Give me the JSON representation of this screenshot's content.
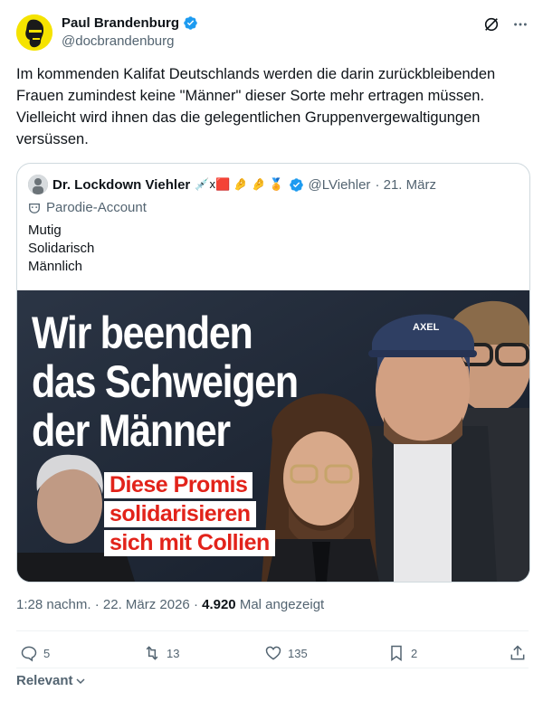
{
  "author": {
    "name": "Paul Brandenburg",
    "handle": "@docbrandenburg",
    "verified": true
  },
  "icons": {
    "header": [
      "grok-icon",
      "more-icon"
    ]
  },
  "tweet": {
    "text": "Im kommenden Kalifat Deutschlands werden die darin zurückbleibenden Frauen zumindest keine \"Männer\" dieser Sorte mehr ertragen müssen. Vielleicht wird ihnen das die gelegentlichen Gruppenvergewaltigungen versüssen."
  },
  "quote": {
    "name": "Dr. Lockdown Viehler",
    "name_emoji": "💉x🟥 🤌 🤌 🏅",
    "handle": "@LViehler",
    "date": "· 21. März",
    "label": "Parodie-Account",
    "lines": [
      "Mutig",
      "Solidarisch",
      "Männlich"
    ],
    "image": {
      "headline": [
        "Wir beenden",
        "das Schweigen",
        "der Männer"
      ],
      "subline": [
        "Diese Promis",
        "solidarisieren",
        "sich mit Collien"
      ],
      "cap_text": "AXEL"
    }
  },
  "meta": {
    "time": "1:28 nachm. · 22. März 2026 · ",
    "views": "4.920",
    "views_label": " Mal angezeigt"
  },
  "actions": {
    "replies": "5",
    "reposts": "13",
    "likes": "135",
    "bookmarks": "2"
  },
  "footer": {
    "sort_label": "Relevant"
  },
  "colors": {
    "accent": "#1d9bf0",
    "muted": "#536471",
    "headline_red": "#e2231a",
    "avatar_bg": "#f5e300"
  }
}
